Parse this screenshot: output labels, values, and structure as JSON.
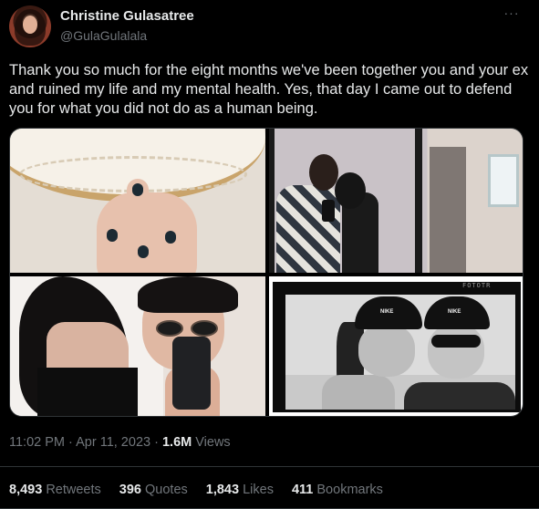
{
  "author": {
    "display_name": "Christine Gulasatree",
    "handle": "@GulaGulalala"
  },
  "more_menu": "···",
  "tweet": {
    "text": "Thank you so much for the eight months we've been together you and your ex and ruined my life and my mental health. Yes, that day I came out to defend you for what you did not do as a human being."
  },
  "media": {
    "photo_strip_brand": "FOTOTR",
    "cap_logo_1": "NIKE",
    "cap_logo_2": "NIKE"
  },
  "meta": {
    "time": "11:02 PM",
    "separator": "·",
    "date": "Apr 11, 2023",
    "views_count": "1.6M",
    "views_label": "Views"
  },
  "stats": {
    "retweets_count": "8,493",
    "retweets_label": "Retweets",
    "quotes_count": "396",
    "quotes_label": "Quotes",
    "likes_count": "1,843",
    "likes_label": "Likes",
    "bookmarks_count": "411",
    "bookmarks_label": "Bookmarks"
  },
  "colors": {
    "background": "#000000",
    "primary_text": "#e7e9ea",
    "secondary_text": "#71767b",
    "border": "#2f3336"
  }
}
